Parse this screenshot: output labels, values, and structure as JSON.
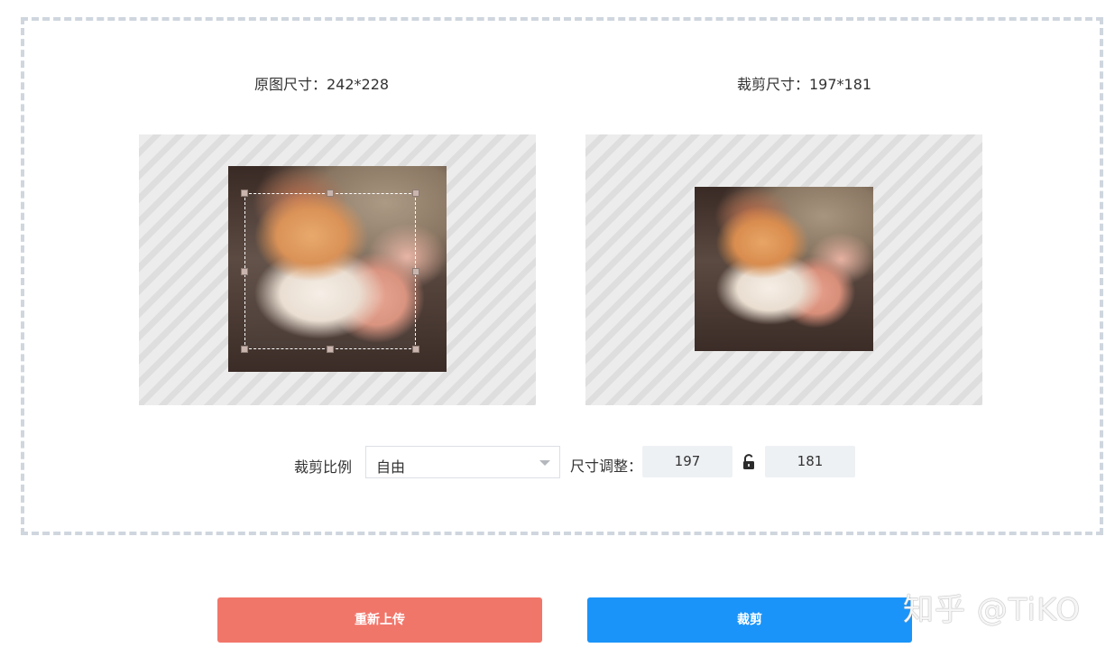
{
  "labels": {
    "original_size": "原图尺寸：242*228",
    "crop_size": "裁剪尺寸：197*181",
    "ratio": "裁剪比例",
    "size_adjust": "尺寸调整："
  },
  "ratio_select": {
    "value": "自由"
  },
  "size_inputs": {
    "width": "197",
    "height": "181"
  },
  "buttons": {
    "reupload": "重新上传",
    "crop": "裁剪"
  },
  "watermark": {
    "text": "知乎 @TiKO"
  },
  "icons": {
    "lock": "unlock-icon",
    "dropdown": "chevron-down-icon"
  },
  "colors": {
    "reupload_button": "#f1766a",
    "crop_button": "#1a94f9",
    "frame_border": "#cfd6de",
    "input_background": "#eef1f4"
  }
}
